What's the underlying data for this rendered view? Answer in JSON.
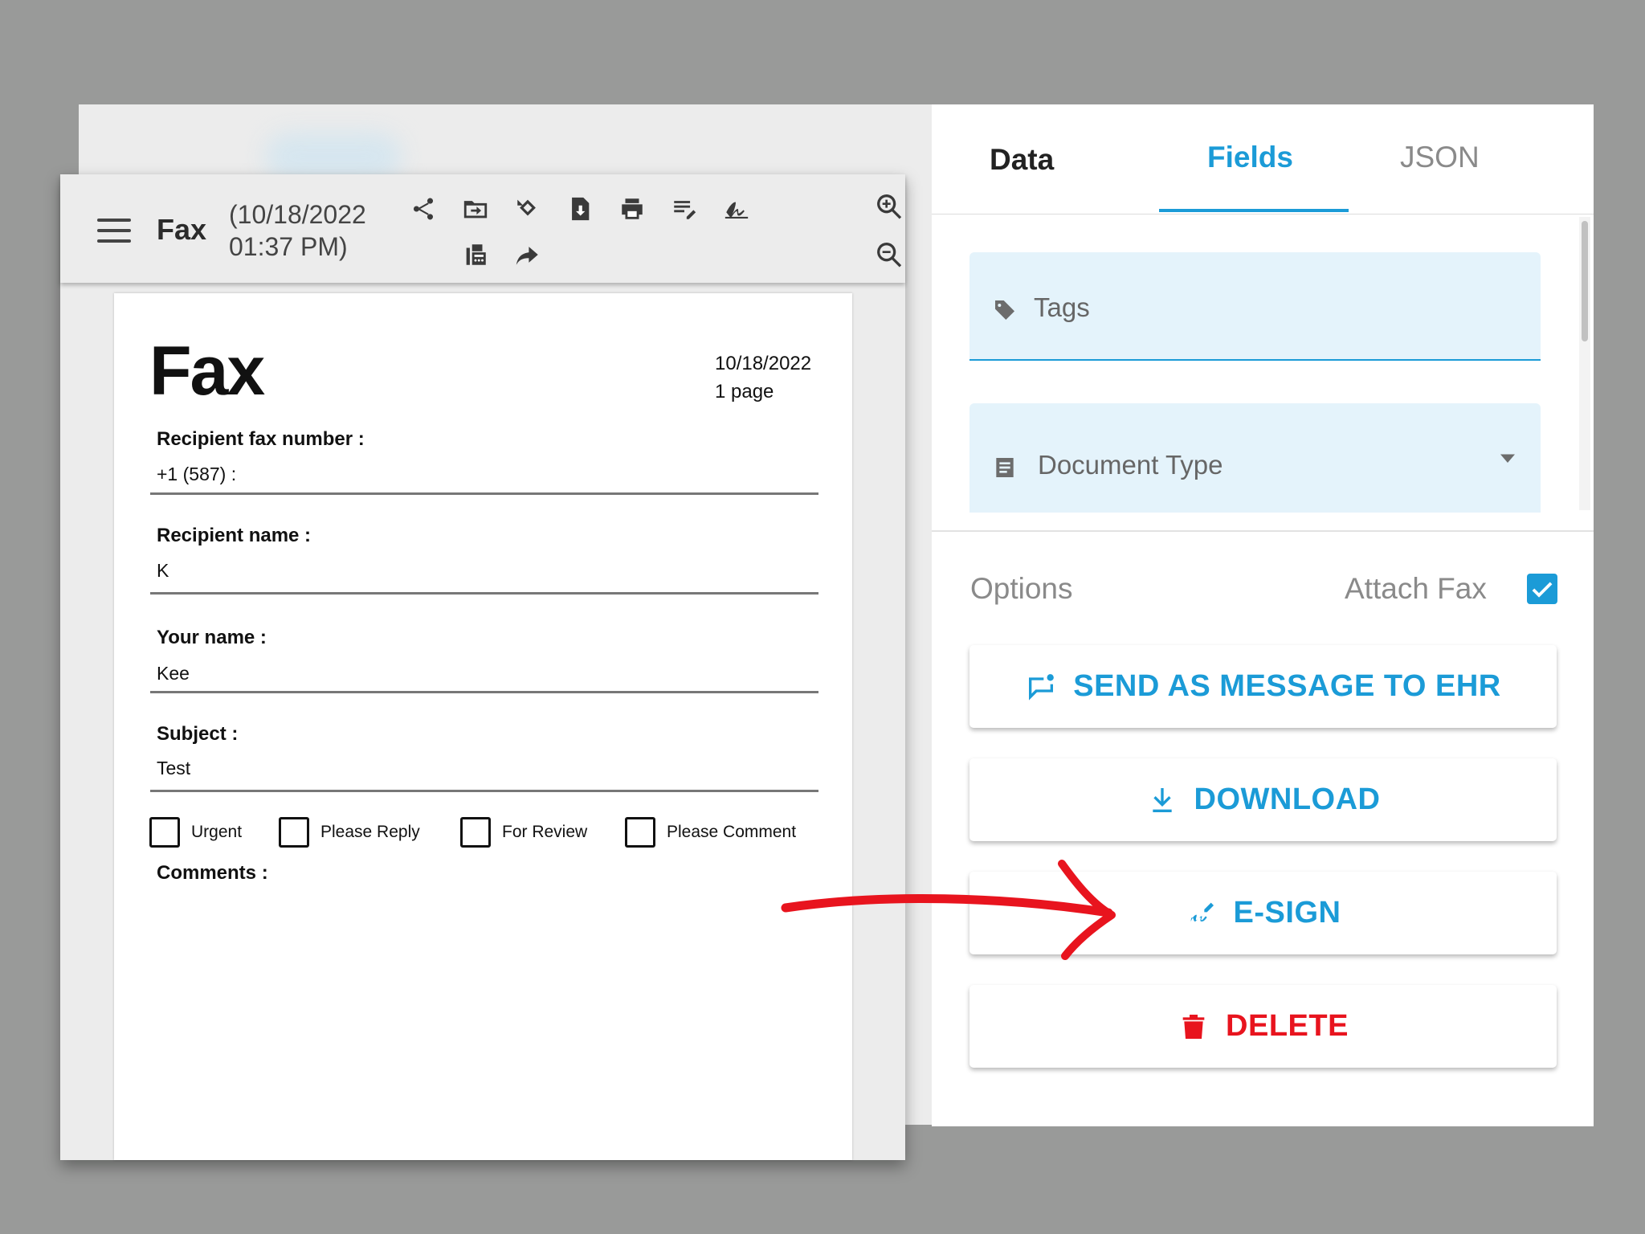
{
  "viewer": {
    "title": "Fax",
    "date_line1": "(10/18/2022",
    "date_line2": "01:37 PM)",
    "toolbar_icons": [
      "share-icon",
      "move-to-folder-icon",
      "rotate-icon",
      "file-download-icon",
      "print-icon",
      "edit-notes-icon",
      "signature-icon",
      "fax-machine-icon",
      "forward-icon",
      "zoom-in-icon",
      "zoom-out-icon"
    ]
  },
  "document": {
    "title": "Fax",
    "date": "10/18/2022",
    "pages": "1 page",
    "recipient_fax_label": "Recipient fax number :",
    "recipient_fax_value": "+1 (587) :",
    "recipient_name_label": "Recipient name :",
    "recipient_name_value": "K",
    "your_name_label": "Your name :",
    "your_name_value": "Kee",
    "subject_label": "Subject :",
    "subject_value": "Test",
    "checkboxes": [
      "Urgent",
      "Please Reply",
      "For Review",
      "Please Comment"
    ],
    "comments_label": "Comments :"
  },
  "panel": {
    "tabs": [
      {
        "label": "Data",
        "color": "#222222"
      },
      {
        "label": "Fields",
        "color": "#1b9bd7",
        "active": true
      },
      {
        "label": "JSON",
        "color": "#8a8a8a"
      }
    ],
    "tags_placeholder": "Tags",
    "doctype_placeholder": "Document Type",
    "options_label": "Options",
    "attach_label": "Attach Fax",
    "attach_checked": true,
    "buttons": [
      {
        "label": "SEND AS MESSAGE TO EHR",
        "color": "#1b9bd7",
        "icon": "message-icon"
      },
      {
        "label": "DOWNLOAD",
        "color": "#1b9bd7",
        "icon": "download-icon"
      },
      {
        "label": "E-SIGN",
        "color": "#1b9bd7",
        "icon": "signature-icon"
      },
      {
        "label": "DELETE",
        "color": "#e8141e",
        "icon": "trash-icon"
      }
    ]
  },
  "annotation": {
    "arrow_color": "#e8141e"
  }
}
